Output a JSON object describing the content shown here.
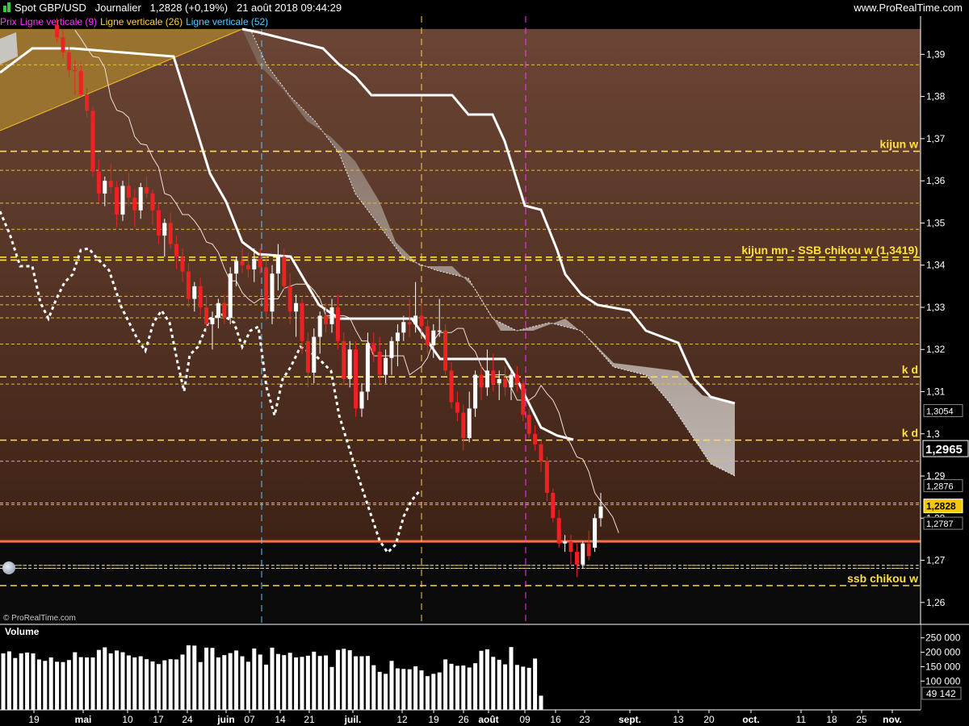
{
  "header": {
    "symbol": "Spot GBP/USD",
    "period": "Journalier",
    "last": "1,2828 (+0,19%)",
    "datetime": "21 août 2018 09:44:29",
    "site": "www.ProRealTime.com"
  },
  "legend": [
    {
      "label": "Prix",
      "color": "#ff33ff"
    },
    {
      "label": "Ligne verticale (9)",
      "color": "#ff33ff"
    },
    {
      "label": "Ligne verticale (26)",
      "color": "#ffd040"
    },
    {
      "label": "Ligne verticale (52)",
      "color": "#55ccff"
    }
  ],
  "watermark": "© ProRealTime.com",
  "volume_title": "Volume",
  "chart_data": {
    "type": "candlestick",
    "ylim": [
      1.255,
      1.396
    ],
    "y_ticks": [
      "1,39",
      "1,38",
      "1,37",
      "1,36",
      "1,35",
      "1,34",
      "1,33",
      "1,32",
      "1,31",
      "1,3",
      "1,29",
      "1,28",
      "1,27",
      "1,26"
    ],
    "x_ticks": [
      "19",
      "mai",
      "10",
      "17",
      "24",
      "juin",
      "07",
      "14",
      "21",
      "juil.",
      "12",
      "19",
      "26",
      "août",
      "09",
      "16",
      "23",
      "sept.",
      "13",
      "20",
      "oct.",
      "11",
      "18",
      "25",
      "nov."
    ],
    "price_badges": [
      {
        "value": "1,3054",
        "style": "plain"
      },
      {
        "value": "1,2965",
        "style": "big"
      },
      {
        "value": "1,2876",
        "style": "plain"
      },
      {
        "value": "1,2828",
        "style": "yellow"
      },
      {
        "value": "1,2787",
        "style": "plain"
      }
    ],
    "annotations": [
      {
        "text": "kijun w",
        "value": 1.367
      },
      {
        "text": "kijun mn - SSB chikou w (1,3419)",
        "value": 1.3419
      },
      {
        "text": "k d",
        "value": 1.3135
      },
      {
        "text": "k d",
        "value": 1.2985
      },
      {
        "text": "ssb chikou w",
        "value": 1.264
      }
    ],
    "horizontal_levels": [
      1.3875,
      1.367,
      1.3625,
      1.3547,
      1.3485,
      1.3419,
      1.3412,
      1.3326,
      1.3306,
      1.3275,
      1.3213,
      1.3135,
      1.3118,
      1.2985,
      1.2935,
      1.2836,
      1.2832,
      1.2688,
      1.2681,
      1.264
    ],
    "support_line": 1.2745,
    "series": [
      {
        "name": "Prix",
        "color": "#ff33ff",
        "values": [
          [
            1.397,
            1.3985,
            1.393,
            1.394
          ],
          [
            1.394,
            1.396,
            1.389,
            1.3905
          ],
          [
            1.3905,
            1.392,
            1.3845,
            1.3863
          ],
          [
            1.3863,
            1.3885,
            1.3805,
            1.386
          ],
          [
            1.386,
            1.388,
            1.38,
            1.3805
          ],
          [
            1.3805,
            1.382,
            1.375,
            1.3766
          ],
          [
            1.3766,
            1.3775,
            1.361,
            1.3622
          ],
          [
            1.3622,
            1.365,
            1.355,
            1.357
          ],
          [
            1.357,
            1.361,
            1.354,
            1.36
          ],
          [
            1.36,
            1.364,
            1.357,
            1.3585
          ],
          [
            1.3585,
            1.36,
            1.349,
            1.352
          ],
          [
            1.352,
            1.36,
            1.3505,
            1.3588
          ],
          [
            1.3588,
            1.362,
            1.354,
            1.356
          ],
          [
            1.356,
            1.358,
            1.349,
            1.353
          ],
          [
            1.353,
            1.3595,
            1.351,
            1.3585
          ],
          [
            1.3585,
            1.361,
            1.356,
            1.357
          ],
          [
            1.357,
            1.358,
            1.3495,
            1.353
          ],
          [
            1.353,
            1.3545,
            1.345,
            1.347
          ],
          [
            1.347,
            1.351,
            1.342,
            1.35
          ],
          [
            1.35,
            1.3525,
            1.344,
            1.345
          ],
          [
            1.345,
            1.347,
            1.339,
            1.342
          ],
          [
            1.342,
            1.344,
            1.336,
            1.3385
          ],
          [
            1.3385,
            1.3405,
            1.33,
            1.332
          ],
          [
            1.332,
            1.336,
            1.329,
            1.335
          ],
          [
            1.335,
            1.337,
            1.328,
            1.33
          ],
          [
            1.33,
            1.333,
            1.324,
            1.326
          ],
          [
            1.326,
            1.329,
            1.32,
            1.3275
          ],
          [
            1.3275,
            1.332,
            1.325,
            1.331
          ],
          [
            1.331,
            1.333,
            1.326,
            1.3275
          ],
          [
            1.3275,
            1.3395,
            1.326,
            1.338
          ],
          [
            1.338,
            1.342,
            1.335,
            1.341
          ],
          [
            1.341,
            1.344,
            1.338,
            1.34
          ],
          [
            1.34,
            1.343,
            1.337,
            1.339
          ],
          [
            1.339,
            1.344,
            1.336,
            1.3415
          ],
          [
            1.3415,
            1.344,
            1.338,
            1.3395
          ],
          [
            1.3395,
            1.342,
            1.327,
            1.329
          ],
          [
            1.329,
            1.34,
            1.326,
            1.338
          ],
          [
            1.338,
            1.345,
            1.334,
            1.342
          ],
          [
            1.342,
            1.344,
            1.334,
            1.335
          ],
          [
            1.335,
            1.338,
            1.326,
            1.329
          ],
          [
            1.329,
            1.333,
            1.323,
            1.331
          ],
          [
            1.331,
            1.332,
            1.319,
            1.322
          ],
          [
            1.322,
            1.324,
            1.311,
            1.3145
          ],
          [
            1.3145,
            1.325,
            1.312,
            1.323
          ],
          [
            1.323,
            1.329,
            1.319,
            1.328
          ],
          [
            1.328,
            1.331,
            1.324,
            1.326
          ],
          [
            1.326,
            1.332,
            1.324,
            1.33
          ],
          [
            1.33,
            1.333,
            1.32,
            1.322
          ],
          [
            1.322,
            1.324,
            1.3115,
            1.313
          ],
          [
            1.313,
            1.322,
            1.311,
            1.32
          ],
          [
            1.32,
            1.322,
            1.304,
            1.306
          ],
          [
            1.306,
            1.312,
            1.304,
            1.31
          ],
          [
            1.31,
            1.324,
            1.308,
            1.3215
          ],
          [
            1.3215,
            1.324,
            1.317,
            1.3195
          ],
          [
            1.3195,
            1.323,
            1.312,
            1.314
          ],
          [
            1.314,
            1.32,
            1.312,
            1.318
          ],
          [
            1.318,
            1.323,
            1.314,
            1.322
          ],
          [
            1.322,
            1.326,
            1.316,
            1.324
          ],
          [
            1.324,
            1.328,
            1.322,
            1.3265
          ],
          [
            1.3265,
            1.332,
            1.323,
            1.326
          ],
          [
            1.326,
            1.336,
            1.324,
            1.328
          ],
          [
            1.328,
            1.331,
            1.324,
            1.3255
          ],
          [
            1.3255,
            1.327,
            1.319,
            1.321
          ],
          [
            1.321,
            1.326,
            1.318,
            1.3245
          ],
          [
            1.3245,
            1.332,
            1.323,
            1.3245
          ],
          [
            1.3245,
            1.326,
            1.314,
            1.315
          ],
          [
            1.315,
            1.317,
            1.306,
            1.3075
          ],
          [
            1.3075,
            1.31,
            1.303,
            1.305
          ],
          [
            1.305,
            1.307,
            1.296,
            1.299
          ],
          [
            1.299,
            1.31,
            1.298,
            1.306
          ],
          [
            1.306,
            1.315,
            1.304,
            1.314
          ],
          [
            1.314,
            1.316,
            1.308,
            1.311
          ],
          [
            1.311,
            1.32,
            1.309,
            1.315
          ],
          [
            1.315,
            1.319,
            1.31,
            1.312
          ],
          [
            1.312,
            1.315,
            1.308,
            1.313
          ],
          [
            1.313,
            1.316,
            1.309,
            1.311
          ],
          [
            1.311,
            1.315,
            1.308,
            1.314
          ],
          [
            1.314,
            1.316,
            1.31,
            1.312
          ],
          [
            1.312,
            1.313,
            1.303,
            1.3045
          ],
          [
            1.3045,
            1.306,
            1.299,
            1.3
          ],
          [
            1.3,
            1.302,
            1.296,
            1.2975
          ],
          [
            1.2975,
            1.2985,
            1.291,
            1.2935
          ],
          [
            1.2935,
            1.2945,
            1.284,
            1.286
          ],
          [
            1.286,
            1.287,
            1.279,
            1.28
          ],
          [
            1.28,
            1.282,
            1.273,
            1.274
          ],
          [
            1.274,
            1.276,
            1.272,
            1.2745
          ],
          [
            1.2745,
            1.276,
            1.269,
            1.272
          ],
          [
            1.272,
            1.274,
            1.266,
            1.269
          ],
          [
            1.269,
            1.2745,
            1.268,
            1.274
          ],
          [
            1.274,
            1.277,
            1.27,
            1.271
          ],
          [
            1.273,
            1.281,
            1.272,
            1.28
          ],
          [
            1.28,
            1.286,
            1.278,
            1.2828
          ]
        ]
      },
      {
        "name": "volume",
        "ylim": [
          0,
          280000
        ],
        "ticks": [
          "250 000",
          "200 000",
          "150 000",
          "100 000"
        ],
        "last_label": "49 142",
        "values": [
          196000,
          203000,
          180000,
          196000,
          199000,
          196000,
          175000,
          170000,
          182000,
          167000,
          166000,
          173000,
          200000,
          183000,
          182000,
          182000,
          208000,
          217000,
          196000,
          206000,
          200000,
          189000,
          182000,
          186000,
          176000,
          168000,
          159000,
          172000,
          176000,
          175000,
          192000,
          224000,
          223000,
          166000,
          216000,
          215000,
          182000,
          190000,
          197000,
          206000,
          186000,
          167000,
          213000,
          192000,
          157000,
          216000,
          194000,
          190000,
          198000,
          182000,
          184000,
          188000,
          202000,
          187000,
          189000,
          149000,
          208000,
          212000,
          207000,
          186000,
          186000,
          187000,
          155000,
          132000,
          125000,
          170000,
          144000,
          142000,
          141000,
          151000,
          137000,
          117000,
          125000,
          130000,
          175000,
          160000,
          153000,
          154000,
          147000,
          162000,
          205000,
          210000,
          184000,
          174000,
          158000,
          218000,
          156000,
          150000,
          146000,
          178000,
          49142
        ]
      }
    ]
  }
}
